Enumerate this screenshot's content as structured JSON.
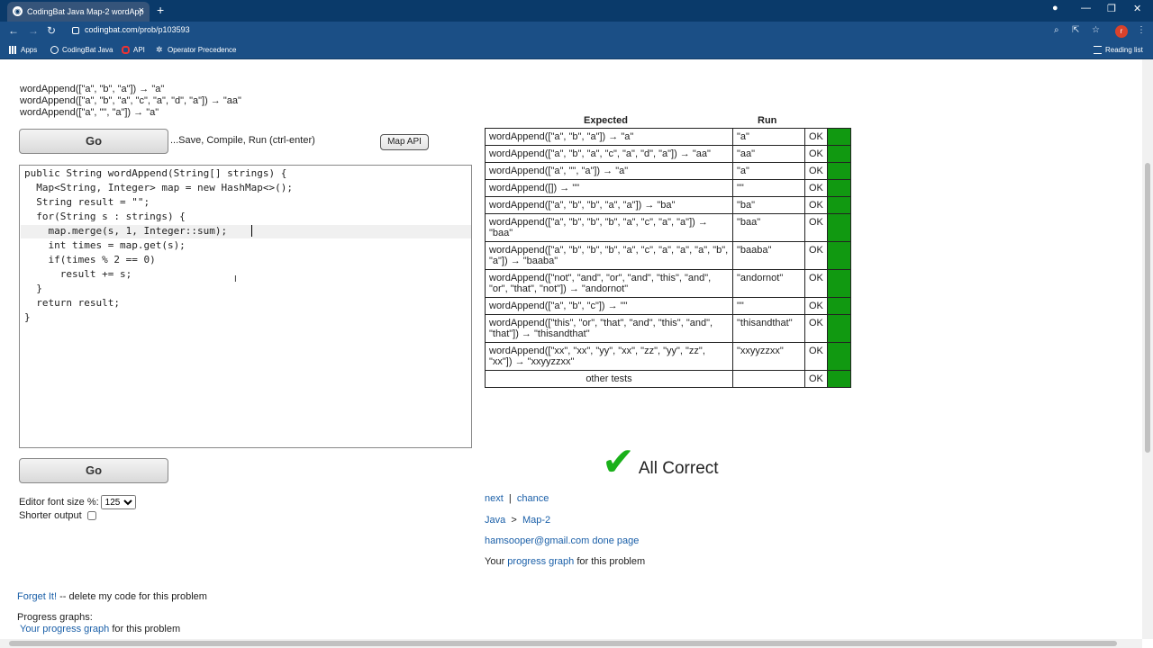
{
  "browser": {
    "tab_title": "CodingBat Java Map-2 wordApp",
    "url": "codingbat.com/prob/p103593",
    "avatar_letter": "r",
    "bookmarks": [
      "Apps",
      "CodingBat Java",
      "API",
      "Operator Precedence"
    ],
    "reading_list": "Reading list"
  },
  "examples": [
    "wordAppend([\"a\", \"b\", \"a\"]) → \"a\"",
    "wordAppend([\"a\", \"b\", \"a\", \"c\", \"a\", \"d\", \"a\"]) → \"aa\"",
    "wordAppend([\"a\", \"\", \"a\"]) → \"a\""
  ],
  "go_label": "Go",
  "save_text": "...Save, Compile, Run (ctrl-enter)",
  "map_api_label": "Map API",
  "code": [
    "public String wordAppend(String[] strings) {",
    "  Map<String, Integer> map = new HashMap<>();",
    "  String result = \"\";",
    "  for(String s : strings) {",
    "    map.merge(s, 1, Integer::sum);",
    "    int times = map.get(s);",
    "    if(times % 2 == 0)",
    "      result += s;",
    "  }",
    "  return result;",
    "}"
  ],
  "font_size_label": "Editor font size %:",
  "font_size_value": "125",
  "shorter_output_label": "Shorter output",
  "table": {
    "header_expected": "Expected",
    "header_run": "Run",
    "rows": [
      {
        "expected": "wordAppend([\"a\", \"b\", \"a\"]) → \"a\"",
        "run": "\"a\"",
        "status": "OK"
      },
      {
        "expected": "wordAppend([\"a\", \"b\", \"a\", \"c\", \"a\", \"d\", \"a\"]) → \"aa\"",
        "run": "\"aa\"",
        "status": "OK"
      },
      {
        "expected": "wordAppend([\"a\", \"\", \"a\"]) → \"a\"",
        "run": "\"a\"",
        "status": "OK"
      },
      {
        "expected": "wordAppend([]) → \"\"",
        "run": "\"\"",
        "status": "OK"
      },
      {
        "expected": "wordAppend([\"a\", \"b\", \"b\", \"a\", \"a\"]) → \"ba\"",
        "run": "\"ba\"",
        "status": "OK"
      },
      {
        "expected": "wordAppend([\"a\", \"b\", \"b\", \"b\", \"a\", \"c\", \"a\", \"a\"]) → \"baa\"",
        "run": "\"baa\"",
        "status": "OK"
      },
      {
        "expected": "wordAppend([\"a\", \"b\", \"b\", \"b\", \"a\", \"c\", \"a\", \"a\", \"a\", \"b\", \"a\"]) → \"baaba\"",
        "run": "\"baaba\"",
        "status": "OK"
      },
      {
        "expected": "wordAppend([\"not\", \"and\", \"or\", \"and\", \"this\", \"and\", \"or\", \"that\", \"not\"]) → \"andornot\"",
        "run": "\"andornot\"",
        "status": "OK"
      },
      {
        "expected": "wordAppend([\"a\", \"b\", \"c\"]) → \"\"",
        "run": "\"\"",
        "status": "OK"
      },
      {
        "expected": "wordAppend([\"this\", \"or\", \"that\", \"and\", \"this\", \"and\", \"that\"]) → \"thisandthat\"",
        "run": "\"thisandthat\"",
        "status": "OK"
      },
      {
        "expected": "wordAppend([\"xx\", \"xx\", \"yy\", \"xx\", \"zz\", \"yy\", \"zz\", \"xx\"]) → \"xxyyzzxx\"",
        "run": "\"xxyyzzxx\"",
        "status": "OK"
      }
    ],
    "other_tests": "other tests",
    "other_status": "OK",
    "pass_color": "#119911"
  },
  "all_correct": "All Correct",
  "nav": {
    "next": "next",
    "sep": "|",
    "chance": "chance",
    "crumb_java": "Java",
    "crumb_sep": ">",
    "crumb_map": "Map-2"
  },
  "user": {
    "email": "hamsooper@gmail.com",
    "done_page": "done page"
  },
  "progress": {
    "prefix": "Your ",
    "link": "progress graph",
    "suffix": " for this problem"
  },
  "forget": {
    "link": "Forget It!",
    "text": " -- delete my code for this problem"
  },
  "progress_graphs_label": "Progress graphs:",
  "progress2": {
    "link": "Your progress graph",
    "suffix": " for this problem"
  }
}
